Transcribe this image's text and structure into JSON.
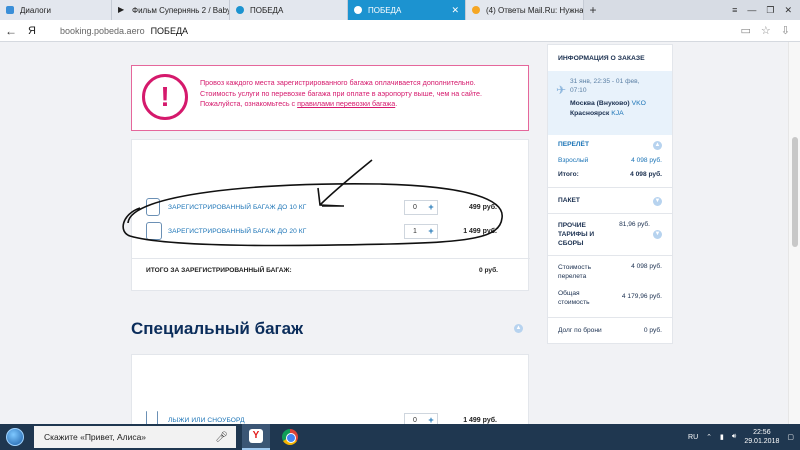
{
  "browser": {
    "tabs": [
      {
        "label": "Диалоги",
        "icon_color": "#3a8fd8",
        "active": false
      },
      {
        "label": "Фильм Супернянь 2 / Baby",
        "icon_color": "#222222",
        "active": false
      },
      {
        "label": "ПОБЕДА",
        "icon_color": "#1c93d0",
        "active": false
      },
      {
        "label": "ПОБЕДА",
        "icon_color": "#ffffff",
        "active": true
      },
      {
        "label": "(4) Ответы Mail.Ru: Нужна",
        "icon_color": "#f5a623",
        "active": false
      }
    ],
    "new_tab": "+",
    "url": "booking.pobeda.aero",
    "page_title": "ПОБЕДА"
  },
  "warning": {
    "line1": "Провоз каждого места зарегистрированного багажа оплачивается дополнительно.",
    "line2": "Стоимость услуги по перевозке багажа при оплате в аэропорту выше, чем на сайте.",
    "line3_prefix": "Пожалуйста, ознакомьтесь с",
    "link": "правилами перевозки багажа",
    "line3_suffix": ".",
    "color": "#d5196c"
  },
  "baggage": {
    "items": [
      {
        "label": "ЗАРЕГИСТРИРОВАННЫЙ БАГАЖ ДО 10 КГ",
        "qty": "0",
        "plus": "+",
        "price": "499 руб."
      },
      {
        "label": "ЗАРЕГИСТРИРОВАННЫЙ БАГАЖ ДО 20 КГ",
        "qty": "1",
        "plus": "+",
        "price": "1 499 руб."
      }
    ],
    "total_label": "ИТОГО ЗА ЗАРЕГИСТРИРОВАННЫЙ БАГАЖ:",
    "total_value": "0 руб."
  },
  "special": {
    "title": "Специальный багаж",
    "items": [
      {
        "label": "ЛЫЖИ ИЛИ СНОУБОРД",
        "qty": "0",
        "plus": "+",
        "price": "1 499 руб."
      }
    ]
  },
  "order": {
    "header": "ИНФОРМАЦИЯ О ЗАКАЗЕ",
    "flight_time_1": "31 янв, 22:35 - 01 фев,",
    "flight_time_2": "07:10",
    "from_city": "Москва (Внуково)",
    "from_code": "VKO",
    "to_city": "Красноярск",
    "to_code": "KJA",
    "flight_label": "ПЕРЕЛЁТ",
    "adult_label": "Взрослый",
    "adult_price": "4 098 руб.",
    "subtotal_label": "Итого:",
    "subtotal_value": "4 098 руб.",
    "package_label": "ПАКЕТ",
    "fees_label_1": "ПРОЧИЕ",
    "fees_label_2": "ТАРИФЫ И",
    "fees_label_3": "СБОРЫ",
    "fees_value": "81,96 руб.",
    "flight_cost_label_1": "Стоимость",
    "flight_cost_label_2": "перелета",
    "flight_cost_value": "4 098 руб.",
    "total_cost_label_1": "Общая",
    "total_cost_label_2": "стоимость",
    "total_cost_value": "4 179,96 руб.",
    "debt_label": "Долг по брони",
    "debt_value": "0 руб."
  },
  "taskbar": {
    "search_placeholder": "Скажите «Привет, Алиса»",
    "lang": "RU",
    "time": "22:56",
    "date": "29.01.2018"
  }
}
